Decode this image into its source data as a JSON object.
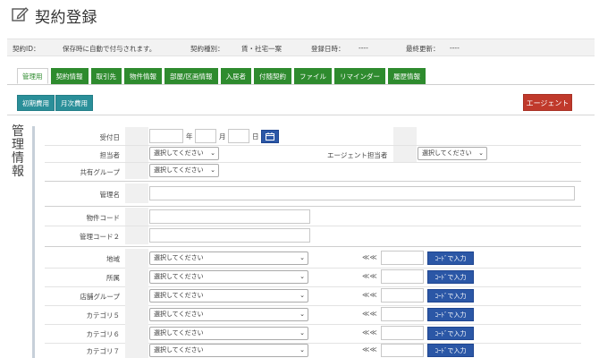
{
  "header": {
    "title": "契約登録",
    "title_icon": "edit-icon"
  },
  "meta": {
    "contract_id_label": "契約ID：",
    "contract_id_value": "保存時に自動で付与されます。",
    "contract_type_label": "契約種別：",
    "contract_type_value": "賃・社宅一案",
    "registered_label": "登録日時：",
    "registered_value": "----",
    "updated_label": "最終更新：",
    "updated_value": "----"
  },
  "tabs": [
    "管理用",
    "契約情報",
    "取引先",
    "物件情報",
    "部屋/区画情報",
    "入居者",
    "付随契約",
    "ファイル",
    "リマインダー",
    "履歴情報"
  ],
  "subtabs": [
    "初期費用",
    "月次費用"
  ],
  "agent_button": "エージェント",
  "section_title": "管理情報",
  "form": {
    "received_date_label": "受付日",
    "year_label": "年",
    "month_label": "月",
    "day_label": "日",
    "calendar_icon": "calendar-icon",
    "assignee_label": "担当者",
    "agent_assignee_label": "エージェント担当者",
    "shared_group_label": "共有グループ",
    "management_name_label": "管理名",
    "property_code_label": "物件コード",
    "management_code2_label": "管理コード２",
    "select_placeholder": "選択してください",
    "code_button_label": "ｺｰﾄﾞで入力",
    "chevron_text": "≪≪",
    "category_rows": [
      {
        "label": "地域"
      },
      {
        "label": "所属"
      },
      {
        "label": "店舗グループ"
      },
      {
        "label": "カテゴリ５"
      },
      {
        "label": "カテゴリ６"
      },
      {
        "label": "カテゴリ７"
      }
    ]
  },
  "colors": {
    "tab_green": "#2e8b2e",
    "subtab_teal": "#2a8f99",
    "agent_red": "#c0392b",
    "button_blue": "#2b57a6"
  }
}
